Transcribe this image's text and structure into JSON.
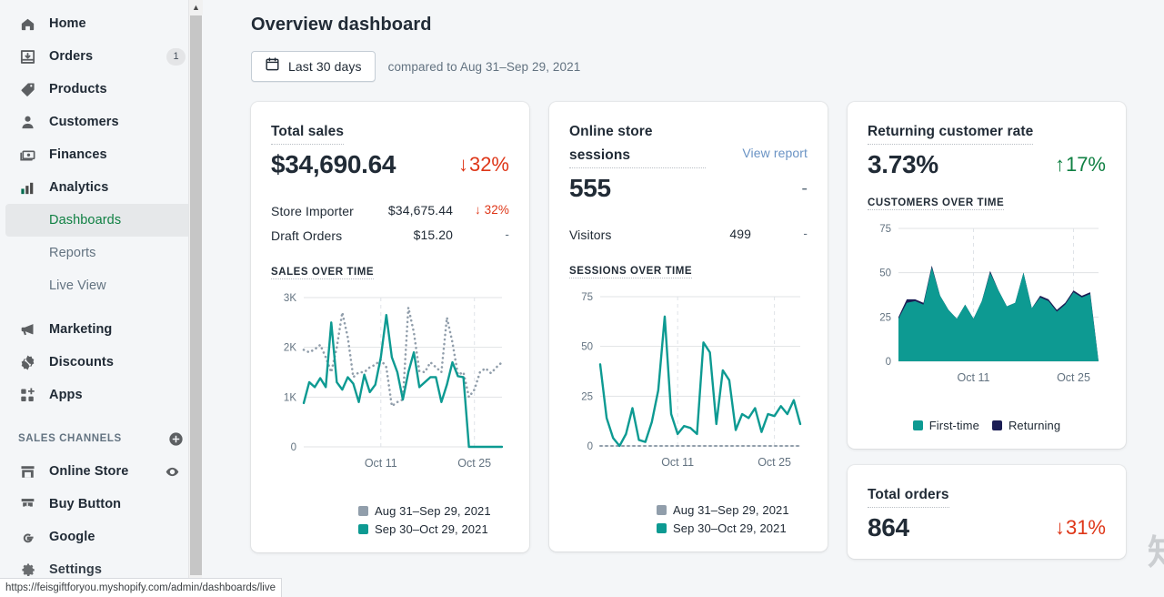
{
  "browser": {
    "status_url": "https://feisgiftforyou.myshopify.com/admin/dashboards/live"
  },
  "watermark": {
    "text": "知乎 @君铭"
  },
  "sidebar": {
    "items": [
      {
        "label": "Home",
        "icon": "home-icon",
        "badge": ""
      },
      {
        "label": "Orders",
        "icon": "orders-icon",
        "badge": "1"
      },
      {
        "label": "Products",
        "icon": "products-tag-icon",
        "badge": ""
      },
      {
        "label": "Customers",
        "icon": "customers-person-icon",
        "badge": ""
      },
      {
        "label": "Finances",
        "icon": "finances-cash-icon",
        "badge": ""
      },
      {
        "label": "Analytics",
        "icon": "analytics-bars-icon",
        "badge": ""
      }
    ],
    "subitems": [
      {
        "label": "Dashboards",
        "active": true
      },
      {
        "label": "Reports",
        "active": false
      },
      {
        "label": "Live View",
        "active": false
      }
    ],
    "items2": [
      {
        "label": "Marketing",
        "icon": "marketing-megaphone-icon",
        "badge": ""
      },
      {
        "label": "Discounts",
        "icon": "discounts-percent-icon",
        "badge": ""
      },
      {
        "label": "Apps",
        "icon": "apps-grid-plus-icon",
        "badge": ""
      }
    ],
    "sales_channels_title": "SALES CHANNELS",
    "channels": [
      {
        "label": "Online Store",
        "icon": "online-store-icon",
        "action": "eye-icon"
      },
      {
        "label": "Buy Button",
        "icon": "buy-button-icon",
        "action": ""
      },
      {
        "label": "Google",
        "icon": "google-g-icon",
        "action": ""
      }
    ],
    "settings_label": "Settings"
  },
  "header": {
    "title": "Overview dashboard",
    "date_range_label": "Last 30 days",
    "compared_label": "compared to Aug 31–Sep 29, 2021"
  },
  "cards": {
    "total_sales": {
      "title": "Total sales",
      "value": "$34,690.64",
      "delta": "32%",
      "delta_dir": "down",
      "breakdown": [
        {
          "name": "Store Importer",
          "value": "$34,675.44",
          "delta": "32%",
          "dir": "down"
        },
        {
          "name": "Draft Orders",
          "value": "$15.20",
          "delta": "-",
          "dir": "flat"
        }
      ],
      "chart_label": "SALES OVER TIME",
      "legend": [
        {
          "label": "Aug 31–Sep 29, 2021",
          "color": "#919eab"
        },
        {
          "label": "Sep 30–Oct 29, 2021",
          "color": "#0d9a92"
        }
      ]
    },
    "sessions": {
      "title": "Online store sessions",
      "view_report": "View report",
      "value": "555",
      "delta": "-",
      "delta_dir": "flat",
      "breakdown": [
        {
          "name": "Visitors",
          "value": "499",
          "delta": "-",
          "dir": "flat"
        }
      ],
      "chart_label": "SESSIONS OVER TIME",
      "legend": [
        {
          "label": "Aug 31–Sep 29, 2021",
          "color": "#919eab"
        },
        {
          "label": "Sep 30–Oct 29, 2021",
          "color": "#0d9a92"
        }
      ]
    },
    "returning_rate": {
      "title": "Returning customer rate",
      "value": "3.73%",
      "delta": "17%",
      "delta_dir": "up",
      "chart_label": "CUSTOMERS OVER TIME",
      "legend": [
        {
          "label": "First-time",
          "color": "#0d9a92"
        },
        {
          "label": "Returning",
          "color": "#1b1d54"
        }
      ]
    },
    "total_orders": {
      "title": "Total orders",
      "value": "864",
      "delta": "31%",
      "delta_dir": "down"
    }
  },
  "chart_data": [
    {
      "id": "sales_over_time",
      "type": "line",
      "title": "SALES OVER TIME",
      "xlabel": "",
      "ylabel": "",
      "ylim": [
        0,
        3000
      ],
      "yticks": [
        "0",
        "1K",
        "2K",
        "3K"
      ],
      "ytick_values": [
        0,
        1000,
        2000,
        3000
      ],
      "xticks": [
        "Oct 11",
        "Oct 25"
      ],
      "xtick_index": [
        11,
        25
      ],
      "grid": true,
      "legend_position": "bottom",
      "series": [
        {
          "name": "Aug 31–Sep 29, 2021",
          "color": "#919eab",
          "style": "dotted",
          "values": [
            1950,
            1900,
            1960,
            2050,
            1800,
            1500,
            2000,
            2700,
            2200,
            1400,
            1500,
            1500,
            1600,
            1650,
            1750,
            1600,
            820,
            900,
            950,
            2800,
            2300,
            1520,
            1500,
            1700,
            1600,
            1500,
            2600,
            2100,
            1450,
            1500,
            1000,
            1150,
            1500,
            1580,
            1480,
            1600,
            1700
          ]
        },
        {
          "name": "Sep 30–Oct 29, 2021",
          "color": "#0d9a92",
          "style": "solid",
          "values": [
            880,
            1300,
            1200,
            1380,
            1200,
            2500,
            1300,
            1150,
            1400,
            1270,
            900,
            1450,
            1100,
            1250,
            1800,
            2650,
            1800,
            1500,
            950,
            1500,
            1900,
            1200,
            1300,
            1400,
            1400,
            900,
            1250,
            1700,
            1420,
            1400,
            0,
            0,
            0,
            0,
            0,
            0,
            0
          ]
        }
      ]
    },
    {
      "id": "sessions_over_time",
      "type": "line",
      "title": "SESSIONS OVER TIME",
      "xlabel": "",
      "ylabel": "",
      "ylim": [
        0,
        75
      ],
      "yticks": [
        "0",
        "25",
        "50",
        "75"
      ],
      "ytick_values": [
        0,
        25,
        50,
        75
      ],
      "xticks": [
        "Oct 11",
        "Oct 25"
      ],
      "grid": true,
      "legend_position": "bottom",
      "series": [
        {
          "name": "Aug 31–Sep 29, 2021",
          "color": "#919eab",
          "style": "dotted-baseline",
          "values": [
            0,
            0,
            0,
            0,
            0,
            0,
            0,
            0,
            0,
            0,
            0,
            0,
            0,
            0,
            0,
            0,
            0,
            0,
            0,
            0,
            0,
            0,
            0,
            0,
            0,
            0,
            0,
            0,
            0,
            0
          ]
        },
        {
          "name": "Sep 30–Oct 29, 2021",
          "color": "#0d9a92",
          "style": "solid",
          "values": [
            41,
            14,
            4,
            0,
            6,
            19,
            3,
            2,
            12,
            28,
            65,
            16,
            6,
            10,
            9,
            6,
            52,
            47,
            11,
            38,
            33,
            8,
            16,
            14,
            19,
            7,
            16,
            15,
            20,
            16,
            23,
            11
          ]
        }
      ]
    },
    {
      "id": "customers_over_time",
      "type": "area",
      "title": "CUSTOMERS OVER TIME",
      "xlabel": "",
      "ylabel": "",
      "ylim": [
        0,
        75
      ],
      "yticks": [
        "0",
        "25",
        "50",
        "75"
      ],
      "ytick_values": [
        0,
        25,
        50,
        75
      ],
      "xticks": [
        "Oct 11",
        "Oct 25"
      ],
      "grid": true,
      "legend_position": "bottom",
      "stacked": true,
      "series": [
        {
          "name": "First-time",
          "color": "#0d9a92",
          "values": [
            24,
            33,
            34,
            32,
            53,
            37,
            29,
            24,
            32,
            24,
            34,
            50,
            40,
            31,
            33,
            50,
            30,
            36,
            34,
            28,
            32,
            39,
            36,
            38,
            0
          ]
        },
        {
          "name": "Returning",
          "color": "#1b1d54",
          "values": [
            1,
            2,
            1,
            1,
            1,
            0,
            0,
            0,
            0,
            0,
            0,
            1,
            0,
            0,
            0,
            0,
            0,
            1,
            1,
            1,
            1,
            1,
            1,
            1,
            0
          ]
        }
      ]
    }
  ]
}
